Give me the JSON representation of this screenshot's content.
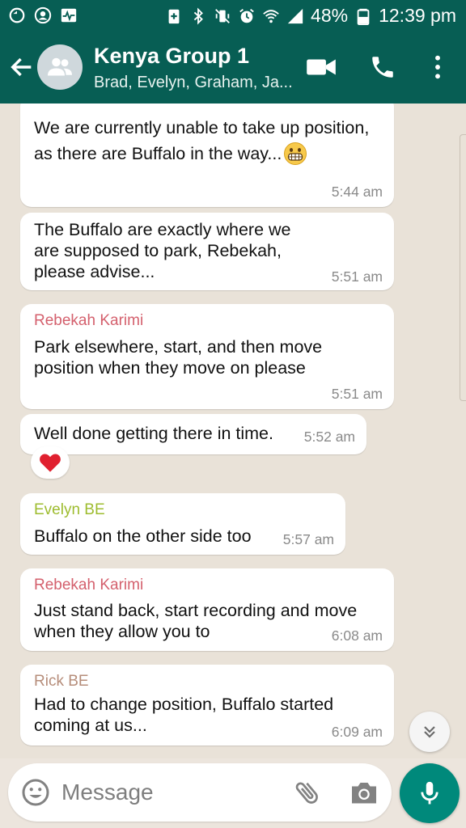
{
  "status_bar": {
    "battery": "48%",
    "time": "12:39 pm"
  },
  "header": {
    "title": "Kenya Group 1",
    "subtitle": "Brad, Evelyn, Graham, Ja..."
  },
  "colors": {
    "header": "#075e54",
    "mic": "#00897b",
    "sender_rebekah": "#d4606d",
    "sender_evelyn": "#9ebc2f",
    "sender_rick": "#b68d7a"
  },
  "messages": [
    {
      "sender": "",
      "text_lines": [
        "We are currently unable to take up position,",
        "as there are Buffalo in the way..."
      ],
      "emoji": "grimacing-face",
      "time": "5:44 am"
    },
    {
      "sender": "",
      "text_lines": [
        "The Buffalo are exactly where we",
        "are supposed to park, Rebekah,",
        "please advise..."
      ],
      "time": "5:51 am"
    },
    {
      "sender": "Rebekah Karimi",
      "text_lines": [
        "Park elsewhere, start, and then move",
        "position when they move on please"
      ],
      "time": "5:51 am"
    },
    {
      "sender": "",
      "text_lines": [
        "Well done getting there in time."
      ],
      "time": "5:52 am",
      "reaction": "red-heart"
    },
    {
      "sender": "Evelyn BE",
      "text_lines": [
        "Buffalo on the other side too"
      ],
      "time": "5:57 am"
    },
    {
      "sender": "Rebekah Karimi",
      "text_lines": [
        "Just stand back, start recording and move",
        "when they allow you to"
      ],
      "time": "6:08 am"
    },
    {
      "sender": "Rick BE",
      "text_lines": [
        "Had to change position, Buffalo started",
        "coming at us..."
      ],
      "time": "6:09 am"
    }
  ],
  "input": {
    "placeholder": "Message"
  },
  "icons": {
    "back": "arrow-left-icon",
    "video": "video-camera-icon",
    "call": "phone-icon",
    "menu": "more-vert-icon",
    "emoji": "emoji-icon",
    "attach": "paperclip-icon",
    "camera": "camera-icon",
    "mic": "microphone-icon",
    "scroll_down": "double-chevron-down-icon"
  }
}
